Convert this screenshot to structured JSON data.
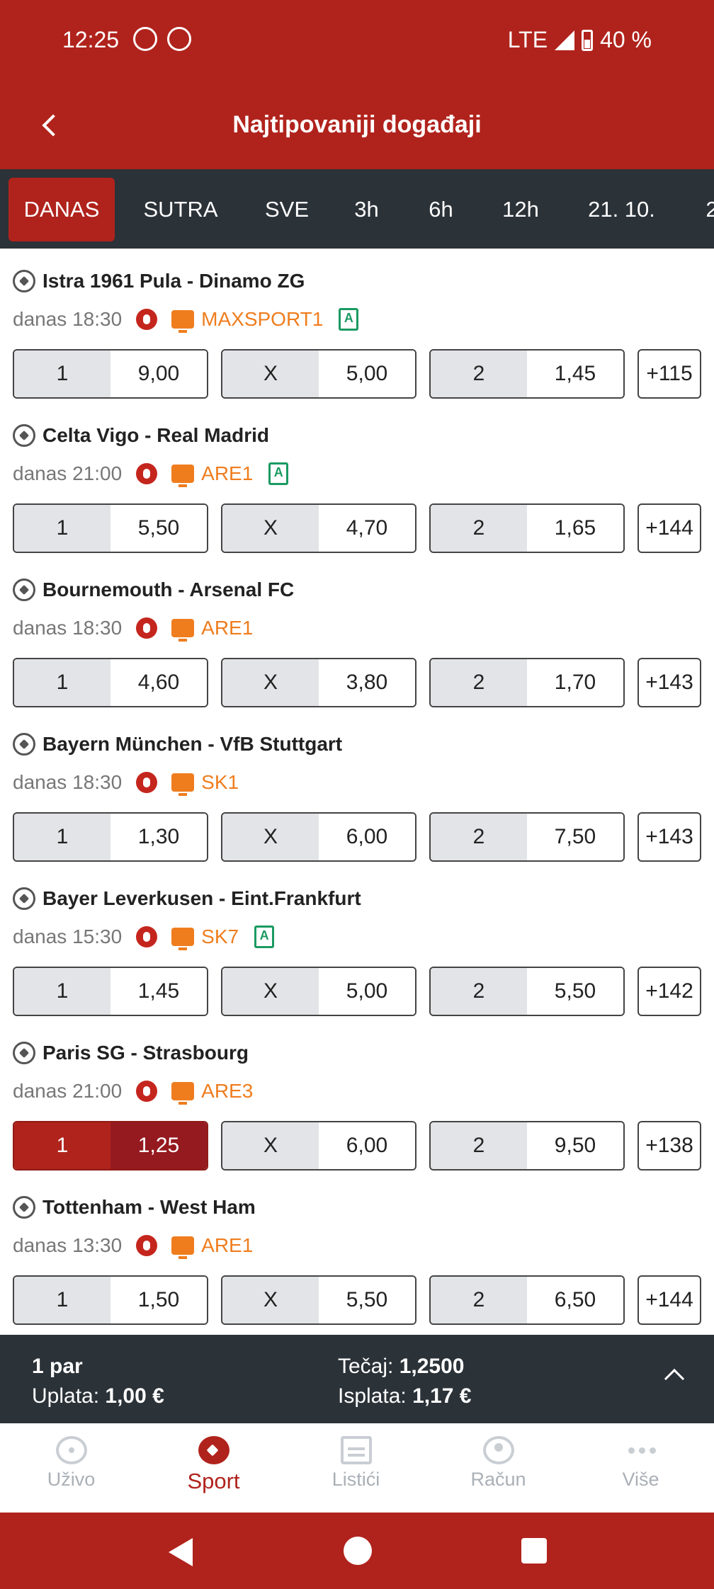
{
  "status_bar": {
    "time": "12:25",
    "network": "LTE",
    "battery": "40 %"
  },
  "header": {
    "title": "Najtipovaniji događaji"
  },
  "tabs": [
    "DANAS",
    "SUTRA",
    "SVE",
    "3h",
    "6h",
    "12h",
    "21. 10.",
    "2"
  ],
  "active_tab": "DANAS",
  "events": [
    {
      "teams": "Istra 1961 Pula - Dinamo ZG",
      "time": "danas 18:30",
      "channel": "MAXSPORT1",
      "has_stats": true,
      "odds": [
        {
          "label": "1",
          "value": "9,00"
        },
        {
          "label": "X",
          "value": "5,00"
        },
        {
          "label": "2",
          "value": "1,45"
        }
      ],
      "more": "+115"
    },
    {
      "teams": "Celta Vigo - Real Madrid",
      "time": "danas 21:00",
      "channel": "ARE1",
      "has_stats": true,
      "odds": [
        {
          "label": "1",
          "value": "5,50"
        },
        {
          "label": "X",
          "value": "4,70"
        },
        {
          "label": "2",
          "value": "1,65"
        }
      ],
      "more": "+144"
    },
    {
      "teams": "Bournemouth - Arsenal FC",
      "time": "danas 18:30",
      "channel": "ARE1",
      "has_stats": false,
      "odds": [
        {
          "label": "1",
          "value": "4,60"
        },
        {
          "label": "X",
          "value": "3,80"
        },
        {
          "label": "2",
          "value": "1,70"
        }
      ],
      "more": "+143"
    },
    {
      "teams": "Bayern München - VfB Stuttgart",
      "time": "danas 18:30",
      "channel": "SK1",
      "has_stats": false,
      "odds": [
        {
          "label": "1",
          "value": "1,30"
        },
        {
          "label": "X",
          "value": "6,00"
        },
        {
          "label": "2",
          "value": "7,50"
        }
      ],
      "more": "+143"
    },
    {
      "teams": "Bayer Leverkusen - Eint.Frankfurt",
      "time": "danas 15:30",
      "channel": "SK7",
      "has_stats": true,
      "odds": [
        {
          "label": "1",
          "value": "1,45"
        },
        {
          "label": "X",
          "value": "5,00"
        },
        {
          "label": "2",
          "value": "5,50"
        }
      ],
      "more": "+142"
    },
    {
      "teams": "Paris SG - Strasbourg",
      "time": "danas 21:00",
      "channel": "ARE3",
      "has_stats": false,
      "odds": [
        {
          "label": "1",
          "value": "1,25",
          "selected": true
        },
        {
          "label": "X",
          "value": "6,00"
        },
        {
          "label": "2",
          "value": "9,50"
        }
      ],
      "more": "+138"
    },
    {
      "teams": "Tottenham - West Ham",
      "time": "danas 13:30",
      "channel": "ARE1",
      "has_stats": false,
      "odds": [
        {
          "label": "1",
          "value": "1,50"
        },
        {
          "label": "X",
          "value": "5,50"
        },
        {
          "label": "2",
          "value": "6,50"
        }
      ],
      "more": "+144"
    }
  ],
  "betslip": {
    "count": "1 par",
    "stake_label": "Uplata:",
    "stake_value": "1,00 €",
    "odds_label": "Tečaj:",
    "odds_value": "1,2500",
    "payout_label": "Isplata:",
    "payout_value": "1,17 €"
  },
  "bottom_nav": [
    {
      "label": "Uživo",
      "icon": "live-icon"
    },
    {
      "label": "Sport",
      "icon": "soccer-ball-icon",
      "active": true
    },
    {
      "label": "Listići",
      "icon": "slips-icon"
    },
    {
      "label": "Račun",
      "icon": "account-icon"
    },
    {
      "label": "Više",
      "icon": "more-icon"
    }
  ],
  "colors": {
    "brand": "#b0231c",
    "dark": "#2b3238",
    "channel": "#ef7d1e",
    "stats": "#1a9a62"
  }
}
